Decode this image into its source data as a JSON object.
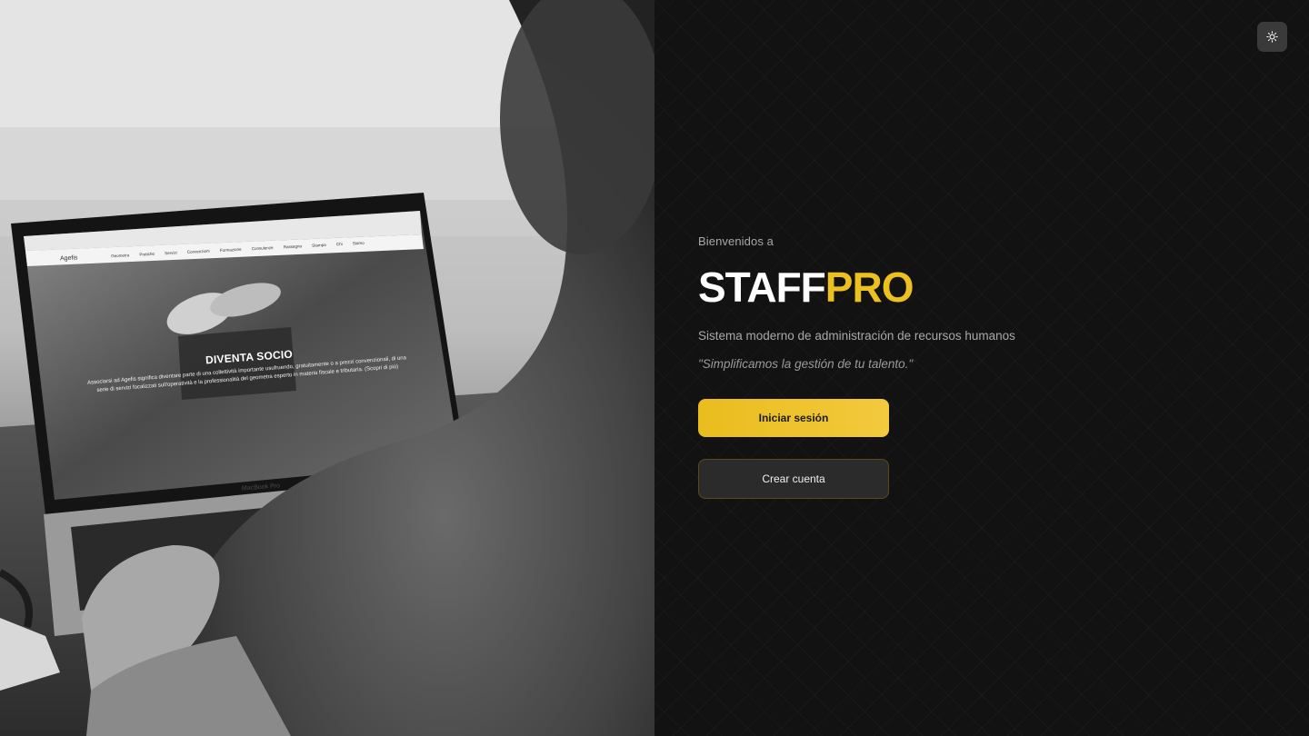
{
  "theme_toggle": {
    "icon": "sun-icon"
  },
  "hero": {
    "welcome": "Bienvenidos a",
    "brand_part1": "STAFF",
    "brand_part2": "PRO",
    "subtitle": "Sistema moderno de administración de recursos humanos",
    "quote": "\"Simplificamos la gestión de tu talento.\""
  },
  "actions": {
    "login_label": "Iniciar sesión",
    "register_label": "Crear cuenta"
  },
  "colors": {
    "accent": "#ECC11F",
    "background": "#121212",
    "text_muted": "#A9A9A9"
  },
  "photo": {
    "laptop_brand": "Agefis",
    "laptop_nav": "Geometra Pratiche Servizi Convenzioni Formazione Consulenze Rassegna Stampa Chi Siamo",
    "laptop_heading": "DIVENTA SOCIO",
    "laptop_body": "Associarsi ad Agefis significa diventare parte di una collettività importante usufruendo, gratuitamente o a prezzi convenzionali, di una serie di servizi focalizzati sull'operatività e la professionalità del geometra esperto in materia fiscale e tributaria. (Scopri di più)",
    "laptop_model": "MacBook Pro"
  }
}
